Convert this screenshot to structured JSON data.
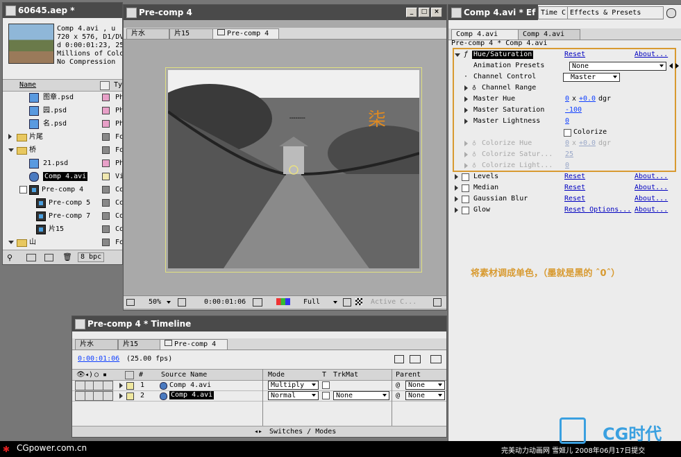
{
  "project": {
    "title": "60645.aep *",
    "info_lines": [
      "Comp 4.avi , u",
      "720 x 576, D1/DV",
      "d 0:00:01:23, 25",
      "Millions of Colo",
      "No Compression"
    ],
    "col_name": "Name",
    "col_type": "Ty",
    "items": [
      {
        "name": "图章.psd",
        "type": "Ph",
        "color": "#e8a0c8",
        "icon": "psd-icon"
      },
      {
        "name": "园.psd",
        "type": "Ph",
        "color": "#e8a0c8",
        "icon": "psd-icon"
      },
      {
        "name": "名.psd",
        "type": "Ph",
        "color": "#e8a0c8",
        "icon": "psd-icon"
      },
      {
        "name": "片尾",
        "type": "Fo",
        "color": "#888888",
        "icon": "folder-icon"
      },
      {
        "name": "桥",
        "type": "Fo",
        "color": "#888888",
        "icon": "folder-icon"
      },
      {
        "name": "21.psd",
        "type": "Ph",
        "color": "#e8a0c8",
        "icon": "psd-icon"
      },
      {
        "name": "Comp 4.avi",
        "type": "Vi",
        "color": "#f0e8b0",
        "icon": "avi-icon",
        "selected": true
      },
      {
        "name": "Pre-comp 4",
        "type": "Co",
        "color": "#888888",
        "icon": "comp-icon"
      },
      {
        "name": "Pre-comp 5",
        "type": "Co",
        "color": "#888888",
        "icon": "comp-icon"
      },
      {
        "name": "Pre-comp 7",
        "type": "Co",
        "color": "#888888",
        "icon": "comp-icon"
      },
      {
        "name": "片15",
        "type": "Co",
        "color": "#888888",
        "icon": "comp-icon"
      },
      {
        "name": "山",
        "type": "Fo",
        "color": "#888888",
        "icon": "folder-icon"
      }
    ],
    "bpc": "8 bpc"
  },
  "comp": {
    "title": "Pre-comp 4",
    "tabs": [
      "片水",
      "片15",
      "Pre-comp 4"
    ],
    "zoom": "50%",
    "timecode": "0:00:01:06",
    "resolution": "Full",
    "camera": "Active C..."
  },
  "effects": {
    "title": "Comp 4.avi * Ef",
    "time_tab": "Time C",
    "presets_tab": "Effects & Presets",
    "tabs": [
      "Comp 4.avi",
      "Comp 4.avi"
    ],
    "breadcrumb": "Pre-comp 4 * Comp 4.avi",
    "hue_sat": {
      "name": "Hue/Saturation",
      "reset": "Reset",
      "about": "About...",
      "animation_presets_label": "Animation Presets",
      "animation_presets_value": "None",
      "channel_control_label": "Channel Control",
      "channel_control_value": "Master",
      "channel_range_label": "Channel Range",
      "master_hue_label": "Master Hue",
      "master_hue_rev": "0",
      "master_hue_x": "x",
      "master_hue_deg": "+0.0",
      "master_hue_unit": "dgr",
      "master_sat_label": "Master Saturation",
      "master_sat_value": "-100",
      "master_light_label": "Master Lightness",
      "master_light_value": "0",
      "colorize_label": "Colorize",
      "colorize_hue_label": "Colorize Hue",
      "colorize_hue_rev": "0",
      "colorize_hue_x": "x",
      "colorize_hue_deg": "+0.0",
      "colorize_hue_unit": "dgr",
      "colorize_sat_label": "Colorize Satur...",
      "colorize_sat_value": "25",
      "colorize_light_label": "Colorize Light...",
      "colorize_light_value": "0"
    },
    "others": [
      {
        "name": "Levels",
        "reset": "Reset",
        "about": "About..."
      },
      {
        "name": "Median",
        "reset": "Reset",
        "about": "About..."
      },
      {
        "name": "Gaussian Blur",
        "reset": "Reset",
        "about": "About..."
      },
      {
        "name": "Glow",
        "reset": "Reset Options...",
        "about": "About..."
      }
    ],
    "note": "将素材调成单色，（墨就是黑的 ˆ0ˆ）"
  },
  "timeline": {
    "title": "Pre-comp 4 * Timeline",
    "tabs": [
      "片水",
      "片15",
      "Pre-comp 4"
    ],
    "timecode": "0:00:01:06",
    "fps": "(25.00 fps)",
    "col_hash": "#",
    "col_source": "Source Name",
    "col_mode": "Mode",
    "col_t": "T",
    "col_trkmat": "TrkMat",
    "col_parent": "Parent",
    "layers": [
      {
        "num": "1",
        "name": "Comp 4.avi",
        "mode": "Multiply",
        "trkmat": "",
        "parent": "None"
      },
      {
        "num": "2",
        "name": "Comp 4.avi",
        "mode": "Normal",
        "trkmat": "None",
        "parent": "None",
        "selected": true
      }
    ],
    "switches": "Switches / Modes"
  },
  "footer": {
    "left": "CGpower.com.cn",
    "right": "完美动力动画网  雪姬儿  2008年06月17日提交",
    "logo": "CG时代"
  },
  "colors": {
    "accent_orange": "#d89a30",
    "link_blue": "#0000c0",
    "value_blue": "#1040ff"
  }
}
